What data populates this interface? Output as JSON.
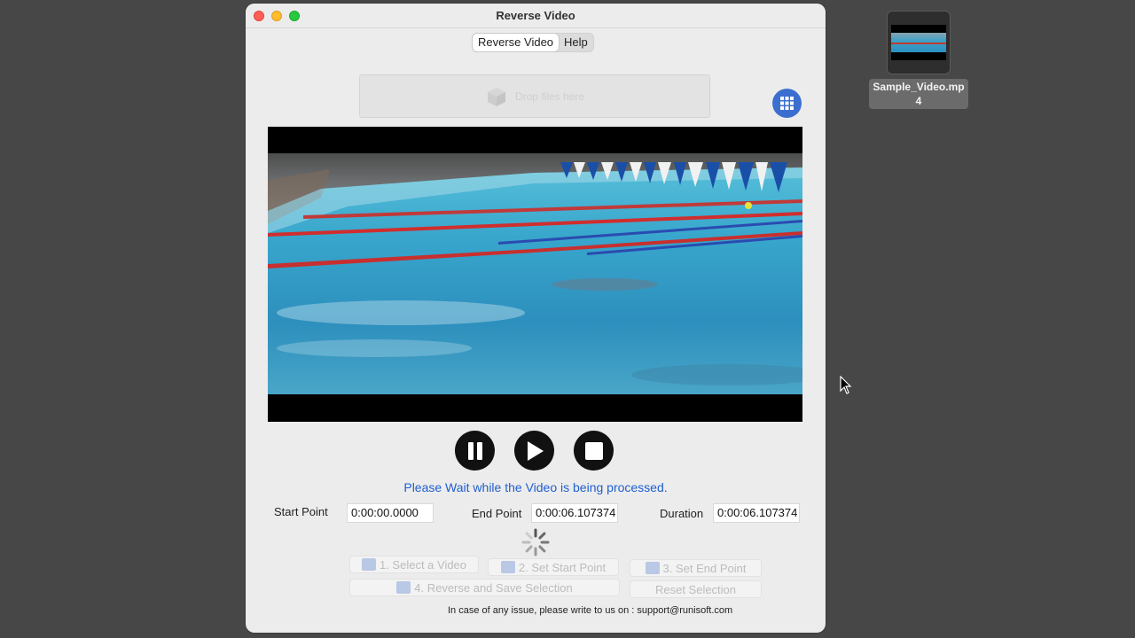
{
  "window": {
    "title": "Reverse Video"
  },
  "tabs": [
    {
      "label": "Reverse Video",
      "active": true
    },
    {
      "label": "Help",
      "active": false
    }
  ],
  "dropzone": {
    "text": "Drop files here"
  },
  "status": {
    "message": "Please Wait while the Video is being processed."
  },
  "fields": {
    "start": {
      "label": "Start Point",
      "value": "0:00:00.0000"
    },
    "end": {
      "label": "End Point",
      "value": "0:00:06.107374"
    },
    "duration": {
      "label": "Duration",
      "value": "0:00:06.107374"
    }
  },
  "buttons": {
    "select_video": "1. Select a Video",
    "set_start": "2. Set Start Point",
    "set_end": "3. Set End Point",
    "reverse_save": "4. Reverse and Save Selection",
    "reset": "Reset Selection"
  },
  "footer": {
    "text": "In case of any issue, please write to us on : support@runisoft.com"
  },
  "desktop": {
    "file_label_line1": "Sample_Video.mp",
    "file_label_line2": "4"
  },
  "colors": {
    "status_blue": "#1f5fcf",
    "grid_button": "#3a6fd0",
    "disabled_text": "#bcbcbc"
  },
  "icons": [
    "box-icon",
    "grid-icon",
    "pause-icon",
    "play-icon",
    "stop-icon",
    "folder-icon",
    "skip-start-icon",
    "skip-end-icon",
    "save-icon",
    "spinner-icon",
    "cursor-icon"
  ]
}
